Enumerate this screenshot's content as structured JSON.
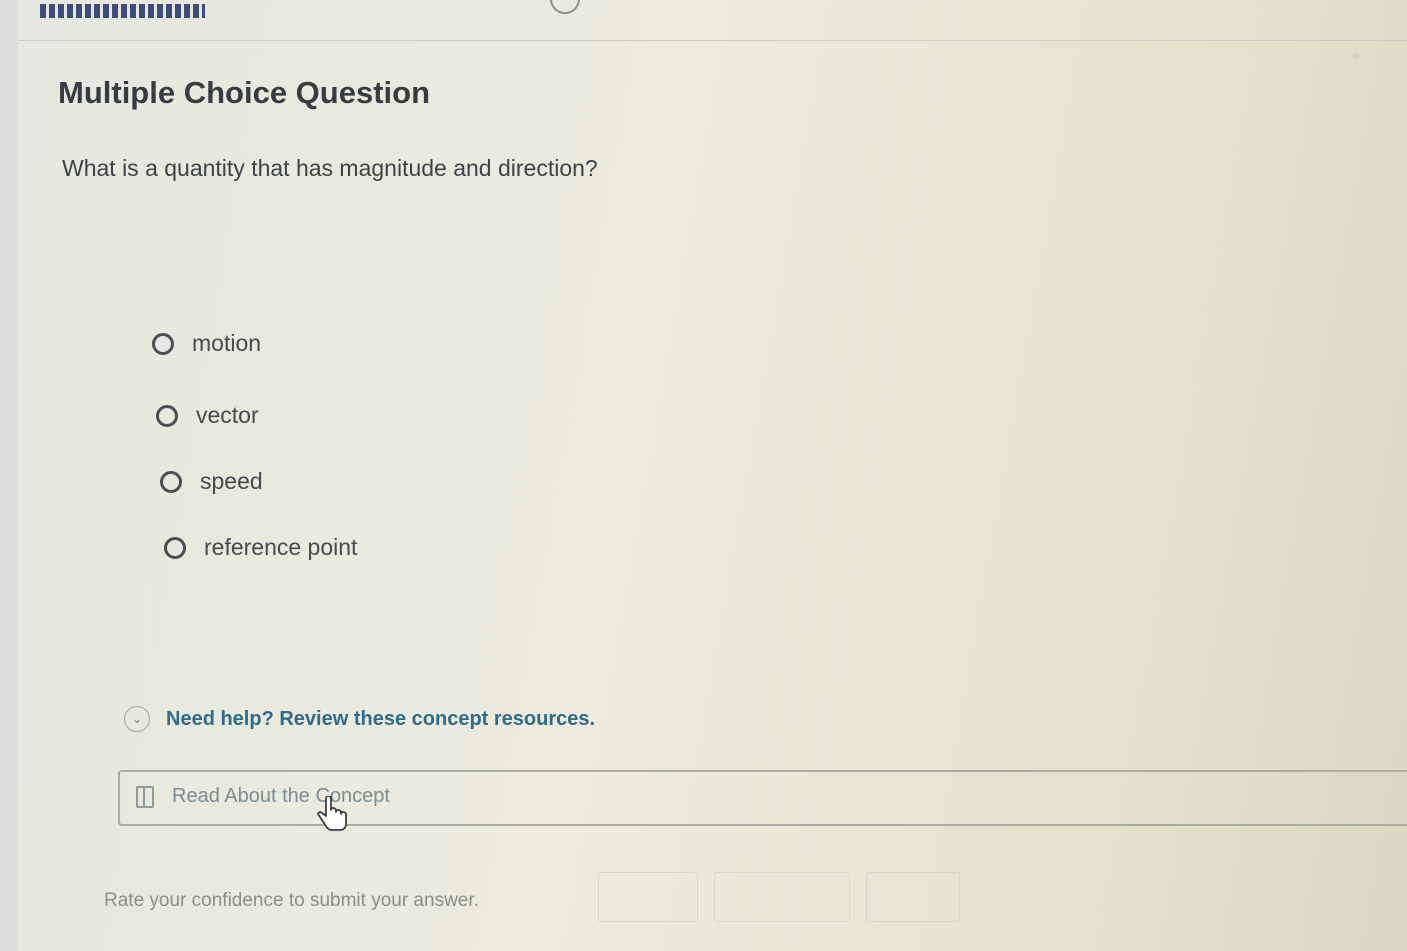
{
  "title": "Multiple Choice Question",
  "question": "What is a quantity that has magnitude and direction?",
  "options": [
    {
      "label": "motion"
    },
    {
      "label": "vector"
    },
    {
      "label": "speed"
    },
    {
      "label": "reference point"
    }
  ],
  "help": {
    "text": "Need help? Review these concept resources.",
    "icon": "chevron-down-icon"
  },
  "resource": {
    "label": "Read About the Concept",
    "icon": "book-icon"
  },
  "confidence": {
    "prompt": "Rate your confidence to submit your answer."
  },
  "colors": {
    "title": "#363c42",
    "link": "#2f6c88",
    "muted_text": "#7c8c93",
    "background": "#ecebdd"
  }
}
